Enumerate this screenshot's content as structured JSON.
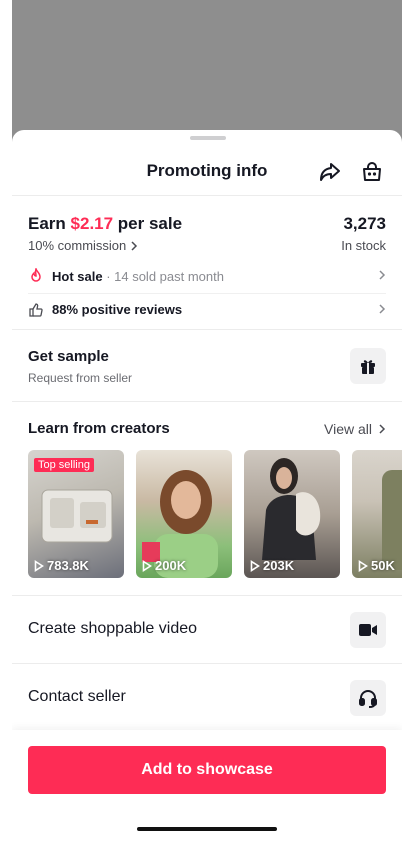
{
  "header": {
    "title": "Promoting info",
    "share_icon": "share-icon",
    "shop_icon": "shopping-bag-icon"
  },
  "earn": {
    "prefix": "Earn ",
    "amount": "$2.17",
    "suffix": " per sale",
    "commission": "10% commission"
  },
  "stock": {
    "value": "3,273",
    "label": "In stock"
  },
  "hot_sale": {
    "label": "Hot sale",
    "detail": " · 14 sold past month"
  },
  "reviews": {
    "label": "88% positive reviews"
  },
  "sample": {
    "title": "Get sample",
    "subtitle": "Request from seller"
  },
  "creators": {
    "title": "Learn from creators",
    "view_all": "View all",
    "videos": [
      {
        "badge": "Top selling",
        "views": "783.8K"
      },
      {
        "views": "200K"
      },
      {
        "views": "203K"
      },
      {
        "views": "50K"
      }
    ]
  },
  "create_video": {
    "label": "Create shoppable video"
  },
  "contact": {
    "label": "Contact seller"
  },
  "cta": {
    "label": "Add to showcase"
  },
  "colors": {
    "accent": "#fe2c55",
    "backdrop": "#8e8e8e"
  }
}
